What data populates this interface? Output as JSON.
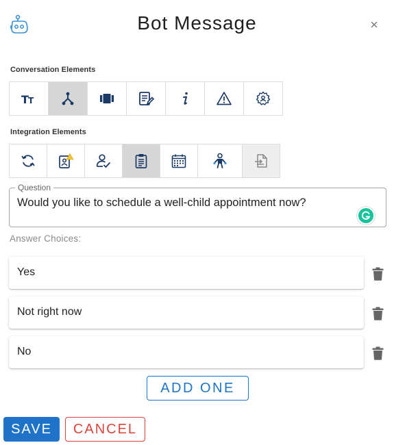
{
  "header": {
    "title": "Bot Message",
    "logo_icon": "bot-head-icon",
    "close_icon": "close-icon"
  },
  "conversation_elements": {
    "label": "Conversation Elements",
    "tools": [
      {
        "icon": "text-size-icon",
        "active": false
      },
      {
        "icon": "branch-icon",
        "active": true
      },
      {
        "icon": "carousel-icon",
        "active": false
      },
      {
        "icon": "edit-form-icon",
        "active": false
      },
      {
        "icon": "info-icon",
        "active": false
      },
      {
        "icon": "warning-icon",
        "active": false
      },
      {
        "icon": "settings-gear-icon",
        "active": false
      }
    ]
  },
  "integration_elements": {
    "label": "Integration Elements",
    "tools": [
      {
        "icon": "sync-icon"
      },
      {
        "icon": "patient-alert-icon"
      },
      {
        "icon": "user-check-icon"
      },
      {
        "icon": "clipboard-icon",
        "active": true
      },
      {
        "icon": "calendar-icon"
      },
      {
        "icon": "child-figure-icon"
      },
      {
        "icon": "document-transfer-icon"
      }
    ]
  },
  "question": {
    "legend": "Question",
    "value": "Would you like to schedule a well-child appointment now?"
  },
  "answers": {
    "label": "Answer Choices:",
    "items": [
      {
        "text": "Yes"
      },
      {
        "text": "Not right now"
      },
      {
        "text": "No"
      }
    ]
  },
  "buttons": {
    "add": "ADD ONE",
    "save": "SAVE",
    "cancel": "CANCEL"
  },
  "colors": {
    "primary": "#1e73c8",
    "danger": "#d9443a",
    "icon": "#1c3a66",
    "grammarly": "#15c39a"
  }
}
